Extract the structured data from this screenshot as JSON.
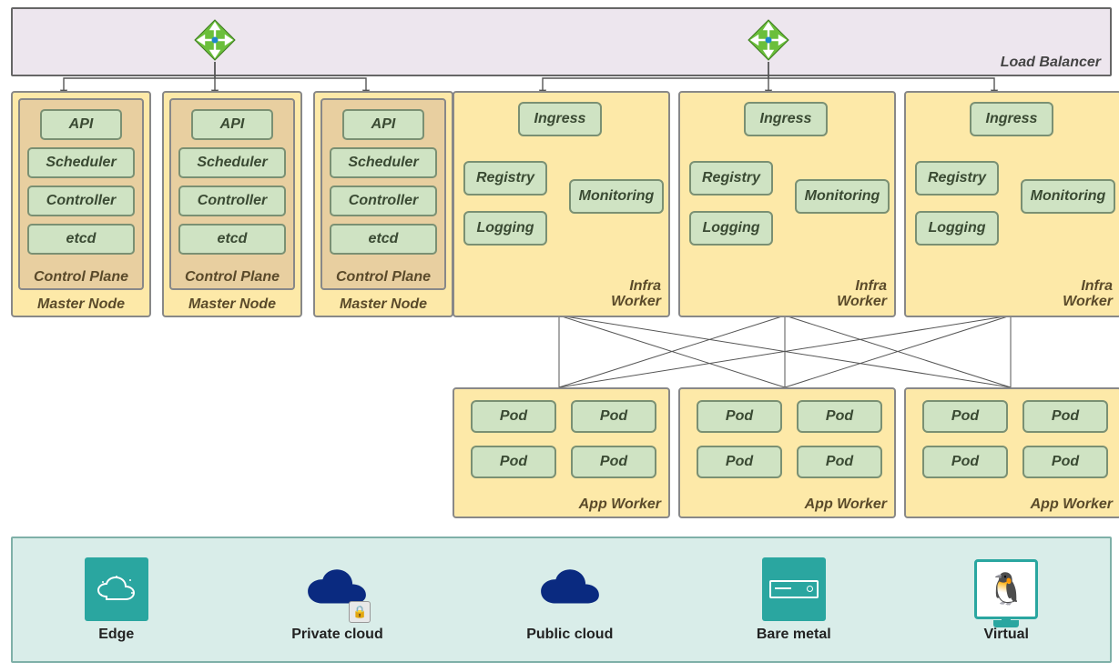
{
  "load_balancer": {
    "label": "Load Balancer"
  },
  "master": {
    "node_label": "Master Node",
    "control_plane_label": "Control Plane",
    "components": {
      "api": "API",
      "scheduler": "Scheduler",
      "controller": "Controller",
      "etcd": "etcd"
    }
  },
  "infra": {
    "label_line1": "Infra",
    "label_line2": "Worker",
    "components": {
      "ingress": "Ingress",
      "registry": "Registry",
      "monitoring": "Monitoring",
      "logging": "Logging"
    }
  },
  "app": {
    "label": "App Worker",
    "pod_label": "Pod"
  },
  "platforms": {
    "edge": "Edge",
    "private_cloud": "Private cloud",
    "public_cloud": "Public cloud",
    "bare_metal": "Bare metal",
    "virtual": "Virtual"
  },
  "colors": {
    "node_bg": "#fde9a8",
    "component_bg": "#cfe3c3",
    "lb_bg": "#ede6ee",
    "platform_bg": "#d9ede9",
    "private_cloud": "#0a2a80",
    "public_cloud": "#0a2a80",
    "accent_teal": "#2aa6a0",
    "route_icon": "#6bbf3b"
  }
}
